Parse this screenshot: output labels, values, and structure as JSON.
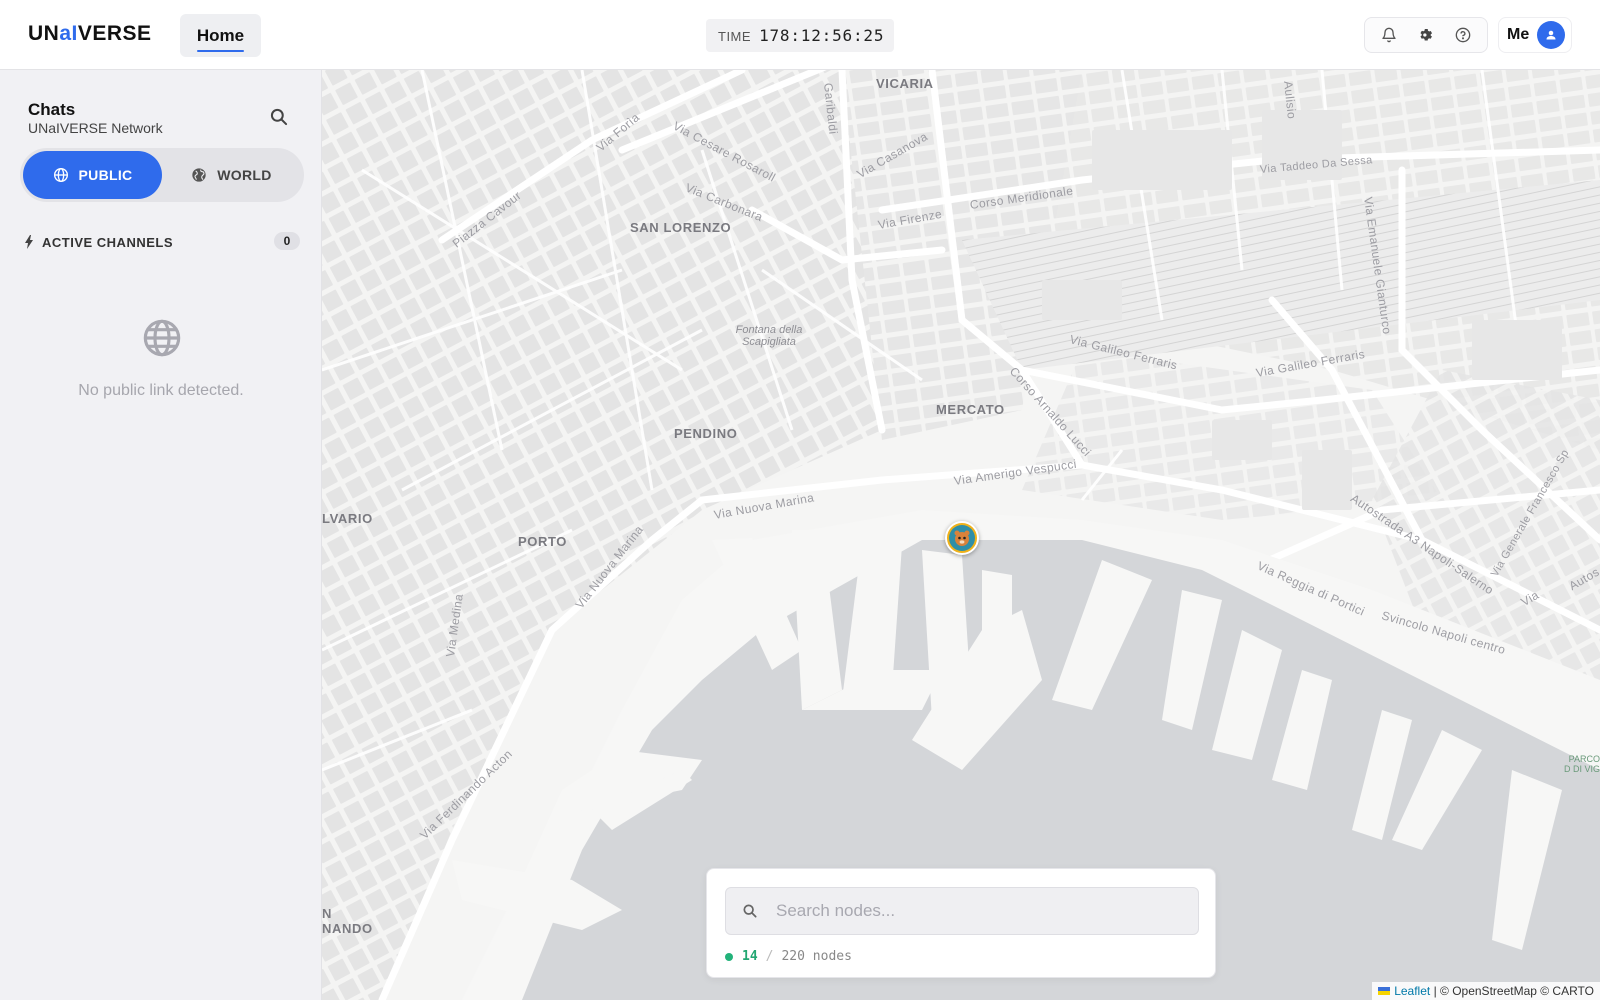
{
  "header": {
    "logo": {
      "part1": "UN",
      "part2": "aI",
      "part3": "VERSE"
    },
    "nav_tab": "Home",
    "time_label": "TIME",
    "time_value": "178:12:56:25",
    "me_label": "Me",
    "icons": [
      "bell-icon",
      "gear-icon",
      "help-icon"
    ]
  },
  "sidebar": {
    "title": "Chats",
    "subtitle": "UNaIVERSE Network",
    "tabs": [
      {
        "label": "PUBLIC",
        "icon": "globe-icon",
        "active": true
      },
      {
        "label": "WORLD",
        "icon": "world-icon",
        "active": false
      }
    ],
    "channels_label": "ACTIVE CHANNELS",
    "channels_count": "0",
    "empty_text": "No public link detected."
  },
  "map": {
    "districts": [
      "VICARIA",
      "SAN LORENZO",
      "MERCATO",
      "PENDINO",
      "PORTO",
      "LVARIO",
      "NANDO"
    ],
    "streets": [
      "Via Forìa",
      "Via Cesare Rosaroll",
      "Via Casanova",
      "Via Carbonara",
      "Piazza Cavour",
      "Via Firenze",
      "Corso Meridionale",
      "Via Taddeo Da Sessa",
      "Via Galileo Ferraris",
      "Via Galileo Ferraris",
      "Corso Arnaldo Lucci",
      "Via Amerigo Vespucci",
      "Via Nuova Marina",
      "Via Nuova Marina",
      "Via Medina",
      "Via Ferdinando Acton",
      "Via Reggia di Portici",
      "Svincolo Napoli centro",
      "Autostrada A3 Napoli-Salerno",
      "Via Emanuele Gianturco",
      "Via Generale Francesco Sp",
      "Autos",
      "Via",
      "Garibaldi",
      "Aulisio"
    ],
    "poi": "Fontana della Scapigliata",
    "park": "PARCO D DI VIG",
    "marker_icon": "avatar-marker-icon",
    "colors": {
      "water": "#d4d6d9",
      "land": "#f5f5f4",
      "block": "#e6e6e6",
      "road": "#ffffff"
    }
  },
  "node_search": {
    "placeholder": "Search nodes...",
    "active": "14",
    "separator": "/",
    "total": "220 nodes"
  },
  "attribution": {
    "leaflet": "Leaflet",
    "rest": "| © OpenStreetMap © CARTO"
  }
}
